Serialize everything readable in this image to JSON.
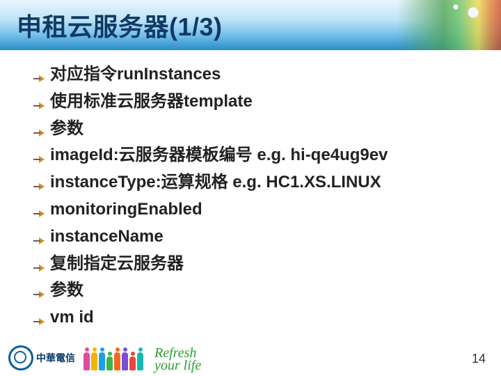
{
  "title": "申租云服务器(1/3)",
  "items": [
    "对应指令runInstances",
    "使用标准云服务器template",
    "参数",
    "imageId:云服务器模板编号 e.g. hi-qe4ug9ev",
    "instanceType:运算规格 e.g. HC1.XS.LINUX",
    "monitoringEnabled",
    " instanceName",
    "复制指定云服务器",
    "参数",
    "vm id"
  ],
  "footer": {
    "company": "中華電信",
    "slogan_line1": "Refresh",
    "slogan_line2": "your life",
    "page": "14"
  }
}
